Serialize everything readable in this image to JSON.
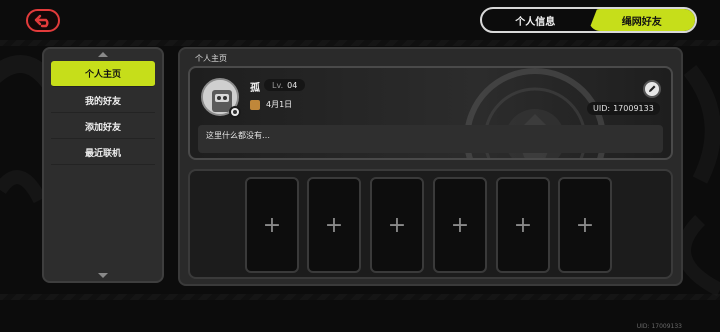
{
  "header": {
    "tabs": [
      {
        "label": "个人信息",
        "active": false
      },
      {
        "label": "绳网好友",
        "active": true
      }
    ]
  },
  "sidebar": {
    "items": [
      {
        "label": "个人主页",
        "active": true
      },
      {
        "label": "我的好友",
        "active": false
      },
      {
        "label": "添加好友",
        "active": false
      },
      {
        "label": "最近联机",
        "active": false
      }
    ]
  },
  "profile": {
    "panel_title": "个人主页",
    "name": "孤",
    "level_prefix": "Lv.",
    "level": "04",
    "birthday": "4月1日",
    "uid_label": "UID:",
    "uid": "17009133",
    "bio": "这里什么都没有…"
  },
  "slots": [
    "+",
    "+",
    "+",
    "+",
    "+",
    "+"
  ],
  "footer": {
    "uid_text": "UID: 17009133"
  },
  "colors": {
    "accent": "#c6de1a",
    "back_button": "#e23b3b",
    "background": "#0c0c0c",
    "panel": "#2a2a2a"
  },
  "icons": {
    "back": "back-arrow-icon",
    "edit": "pencil-icon",
    "birthday": "cake-icon",
    "badge": "gear-badge-icon"
  }
}
